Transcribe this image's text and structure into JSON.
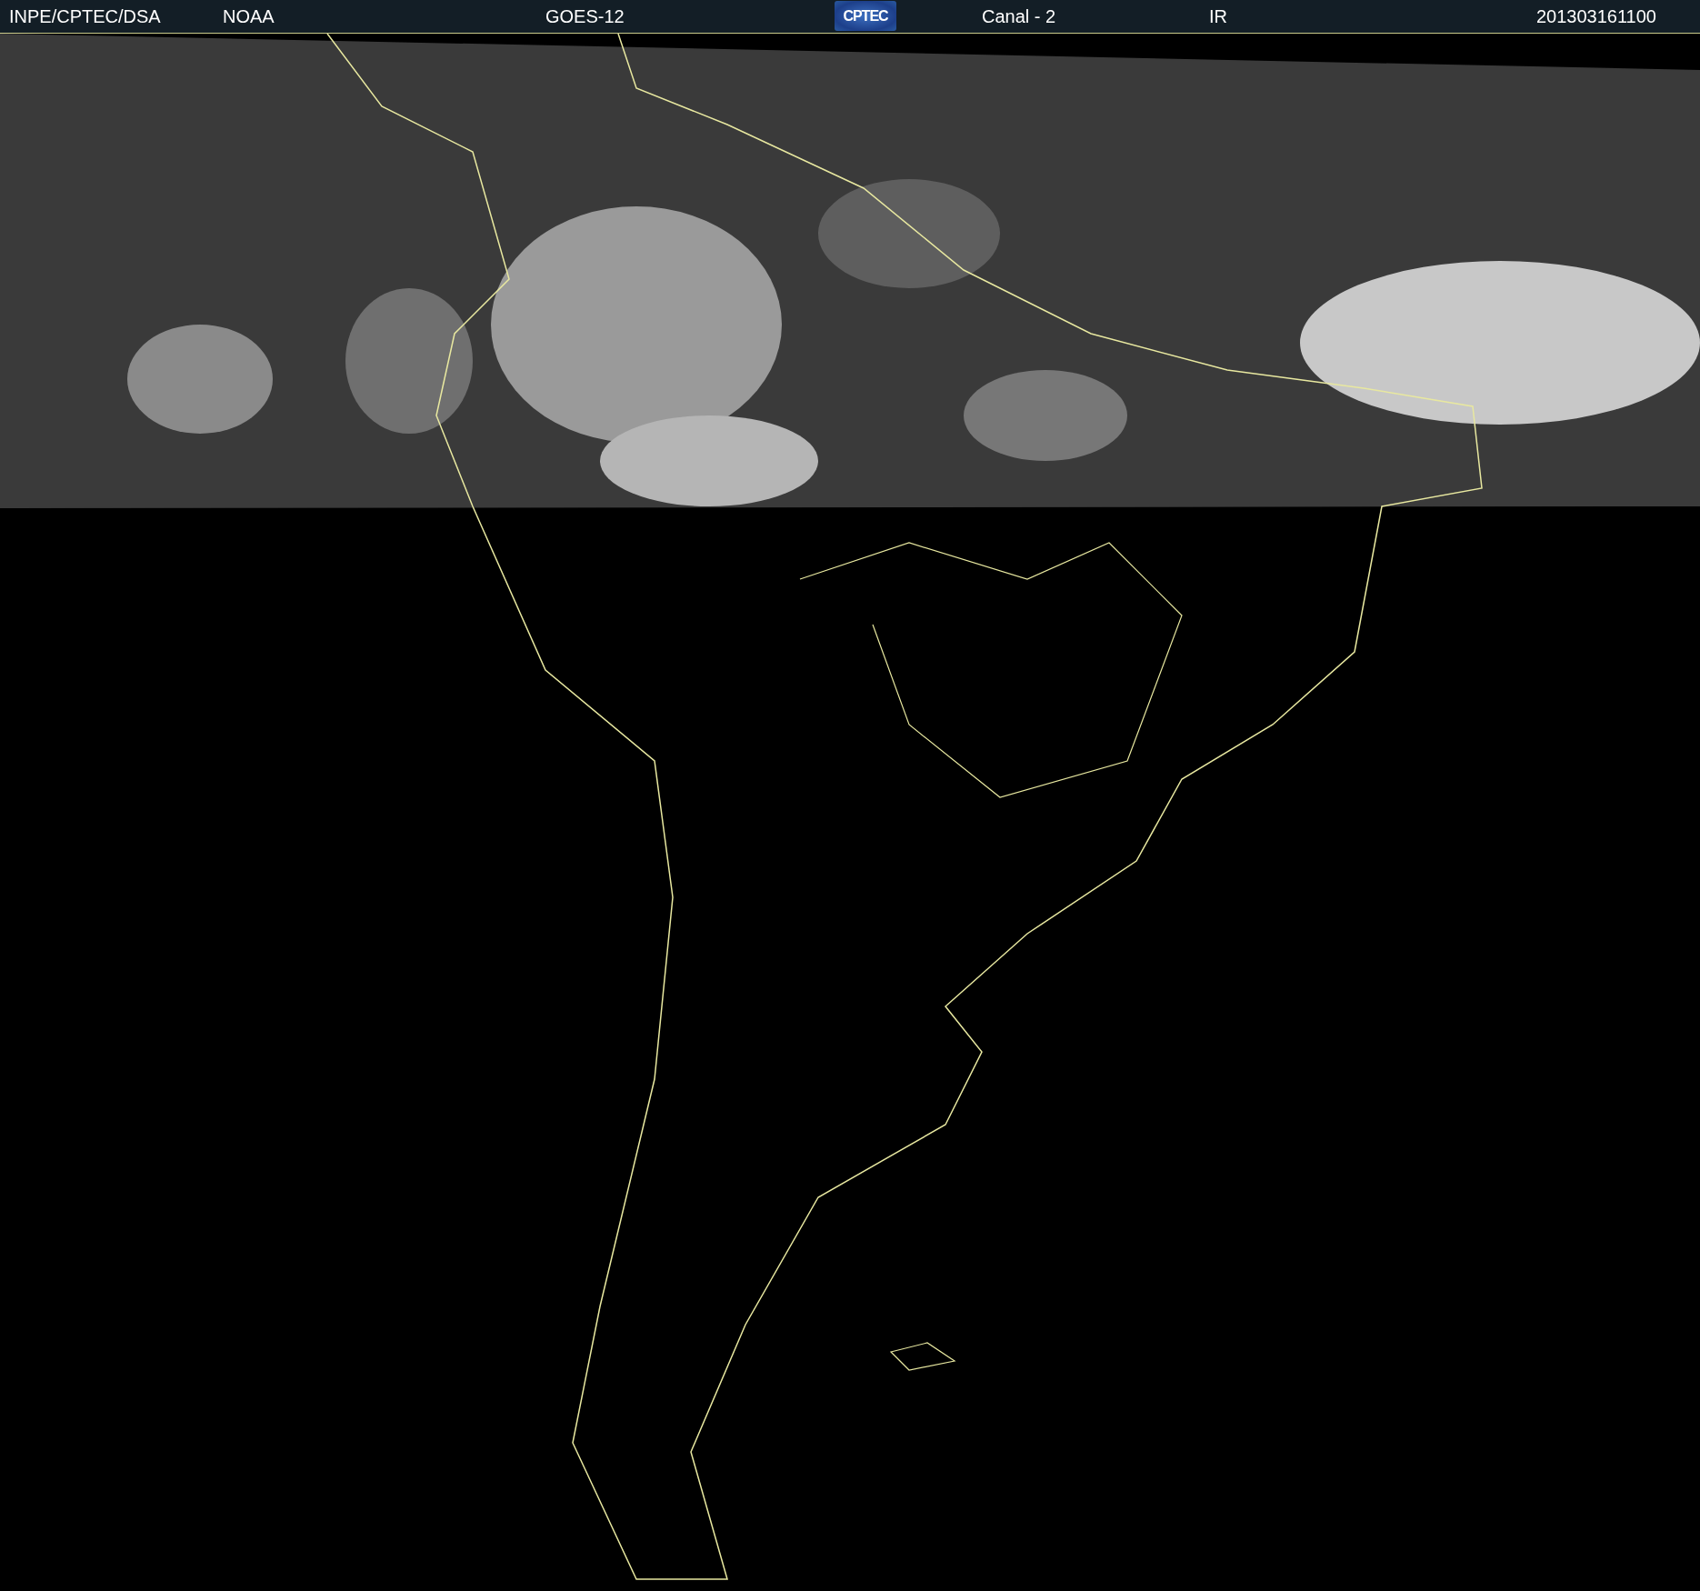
{
  "header": {
    "items": [
      {
        "kind": "text",
        "text": "INPE/CPTEC/DSA"
      },
      {
        "kind": "text",
        "text": "NOAA"
      },
      {
        "kind": "text",
        "text": "GOES-12"
      },
      {
        "kind": "logo",
        "text": "CPTEC"
      },
      {
        "kind": "text",
        "text": "Canal - 2"
      },
      {
        "kind": "text",
        "text": "IR"
      },
      {
        "kind": "text",
        "text": "201303161100"
      }
    ]
  }
}
